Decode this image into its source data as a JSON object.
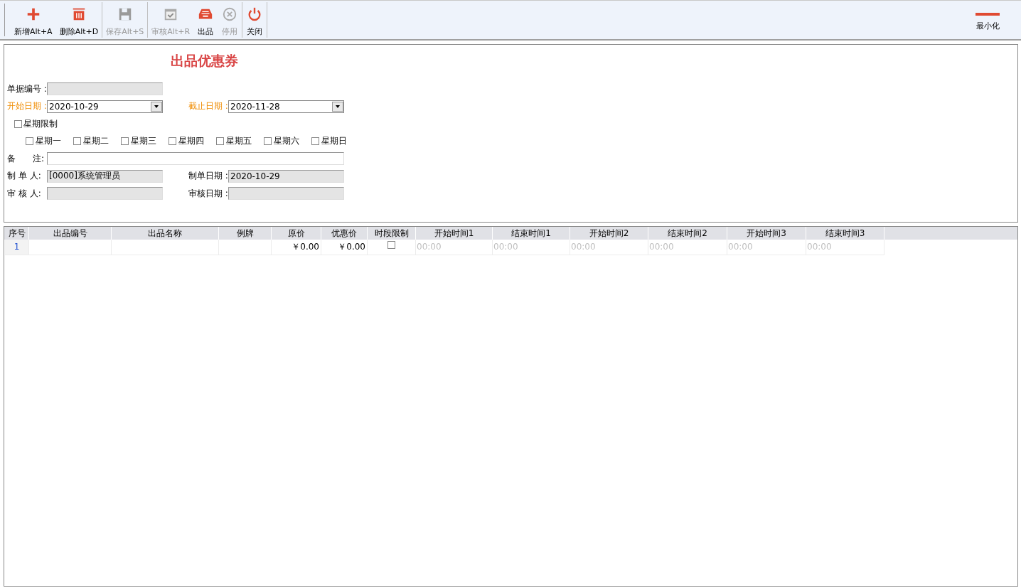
{
  "toolbar": {
    "buttons": [
      {
        "label": "新增Alt+A",
        "kind": "plus",
        "disabled": false
      },
      {
        "label": "删除Alt+D",
        "kind": "trash",
        "disabled": false
      },
      {
        "label": "保存Alt+S",
        "kind": "save",
        "disabled": true
      },
      {
        "label": "审核Alt+R",
        "kind": "approve",
        "disabled": true
      },
      {
        "label": "出品",
        "kind": "tray",
        "disabled": false
      },
      {
        "label": "停用",
        "kind": "stop",
        "disabled": true
      },
      {
        "label": "关闭",
        "kind": "power",
        "disabled": false
      }
    ],
    "minimize": {
      "label": "最小化"
    }
  },
  "form": {
    "title": "出品优惠券",
    "doc_no": {
      "label": "单据编号 :"
    },
    "start_date": {
      "label": "开始日期 :",
      "value": "2020-10-29",
      "required": true
    },
    "end_date": {
      "label": "截止日期 :",
      "value": "2020-11-28",
      "required": true
    },
    "weekday_limit": {
      "label": "星期限制",
      "checked": false
    },
    "weekdays": [
      {
        "label": "星期一",
        "checked": false
      },
      {
        "label": "星期二",
        "checked": false
      },
      {
        "label": "星期三",
        "checked": false
      },
      {
        "label": "星期四",
        "checked": false
      },
      {
        "label": "星期五",
        "checked": false
      },
      {
        "label": "星期六",
        "checked": false
      },
      {
        "label": "星期日",
        "checked": false
      }
    ],
    "remark": {
      "label": "备　　注:"
    },
    "creator": {
      "label": "制 单 人:",
      "value": "[0000]系统管理员"
    },
    "create_date": {
      "label": "制单日期 :",
      "value": "2020-10-29"
    },
    "reviewer": {
      "label": "审 核 人:"
    },
    "review_date": {
      "label": "审核日期 :"
    }
  },
  "table": {
    "columns": [
      "序号",
      "出品编号",
      "出品名称",
      "例牌",
      "原价",
      "优惠价",
      "时段限制",
      "开始时间1",
      "结束时间1",
      "开始时间2",
      "结束时间2",
      "开始时间3",
      "结束时间3"
    ],
    "rows": [
      {
        "no": "1",
        "price": "￥0.00",
        "discount_price": "￥0.00",
        "time_limited": false,
        "times": [
          "00:00",
          "00:00",
          "00:00",
          "00:00",
          "00:00",
          "00:00"
        ]
      }
    ]
  }
}
